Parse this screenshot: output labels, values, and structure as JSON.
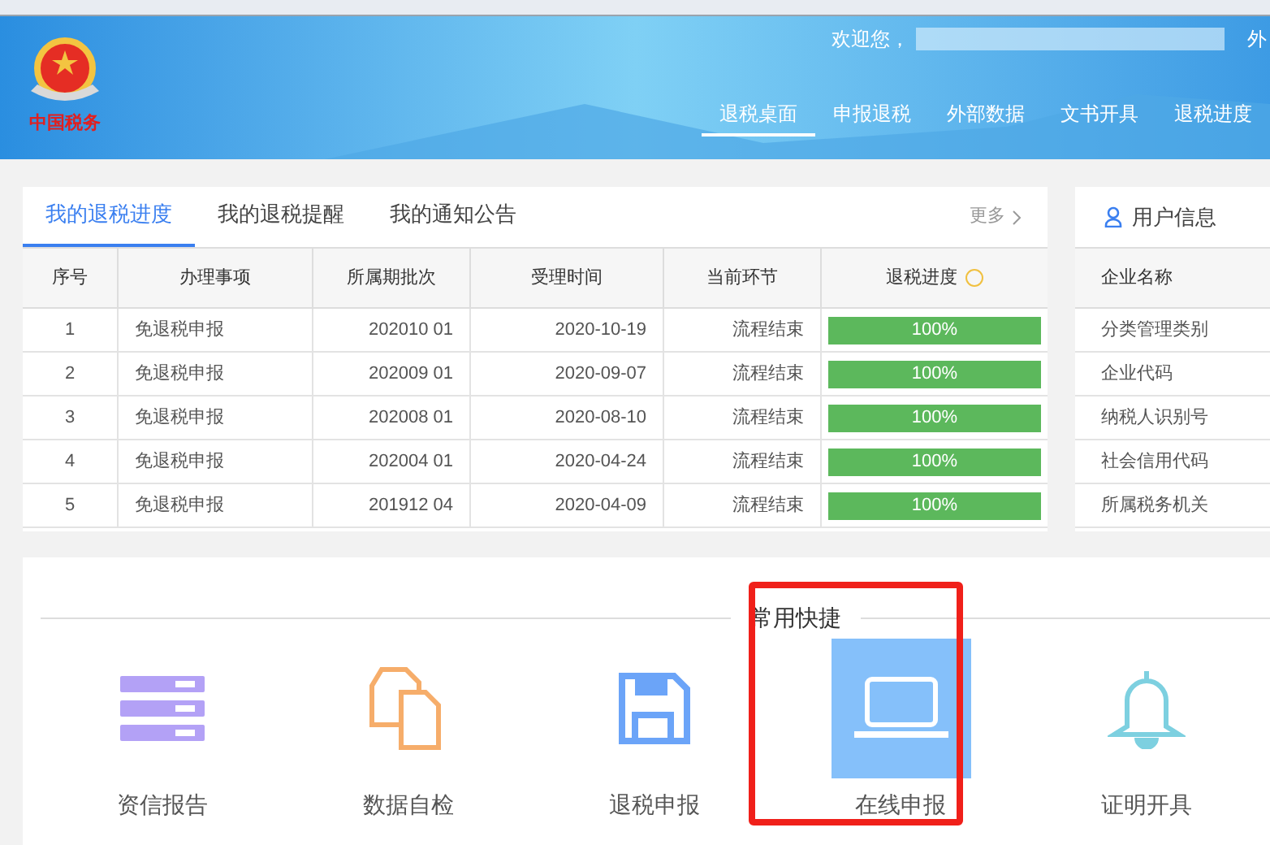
{
  "header": {
    "logo_text": "中国税务",
    "welcome": "欢迎您，",
    "welcome_cut": "外",
    "nav": [
      {
        "label": "退税桌面",
        "selected": true
      },
      {
        "label": "申报退税",
        "selected": false
      },
      {
        "label": "外部数据",
        "selected": false
      },
      {
        "label": "文书开具",
        "selected": false
      },
      {
        "label": "退税进度",
        "selected": false
      }
    ]
  },
  "progress_panel": {
    "tabs": [
      {
        "label": "我的退税进度",
        "selected": true
      },
      {
        "label": "我的退税提醒",
        "selected": false
      },
      {
        "label": "我的通知公告",
        "selected": false
      }
    ],
    "more": "更多",
    "table": {
      "columns": [
        "序号",
        "办理事项",
        "所属期批次",
        "受理时间",
        "当前环节",
        "退税进度"
      ],
      "rows": [
        {
          "cells": [
            "1",
            "免退税申报",
            "202010 01",
            "2020-10-19",
            "流程结束"
          ],
          "level": 1,
          "reading": "100%"
        },
        {
          "cells": [
            "2",
            "免退税申报",
            "202009 01",
            "2020-09-07",
            "流程结束"
          ],
          "level": 1,
          "reading": "100%"
        },
        {
          "cells": [
            "3",
            "免退税申报",
            "202008 01",
            "2020-08-10",
            "流程结束"
          ],
          "level": 1,
          "reading": "100%"
        },
        {
          "cells": [
            "4",
            "免退税申报",
            "202004 01",
            "2020-04-24",
            "流程结束"
          ],
          "level": 1,
          "reading": "100%"
        },
        {
          "cells": [
            "5",
            "免退税申报",
            "201912 04",
            "2020-04-09",
            "流程结束"
          ],
          "level": 1,
          "reading": "100%"
        }
      ]
    }
  },
  "user_info": {
    "title": "用户信息",
    "header": "企业名称",
    "fields": [
      "分类管理类别",
      "企业代码",
      "纳税人识别号",
      "社会信用代码",
      "所属税务机关"
    ]
  },
  "shortcuts": {
    "title": "常用快捷",
    "items": [
      {
        "label": "资信报告",
        "kind": "report",
        "selected": false
      },
      {
        "label": "数据自检",
        "kind": "documents",
        "selected": false
      },
      {
        "label": "退税申报",
        "kind": "save",
        "selected": false
      },
      {
        "label": "在线申报",
        "kind": "laptop",
        "selected": true,
        "highlighted": true
      },
      {
        "label": "证明开具",
        "kind": "bell",
        "selected": false
      }
    ]
  }
}
